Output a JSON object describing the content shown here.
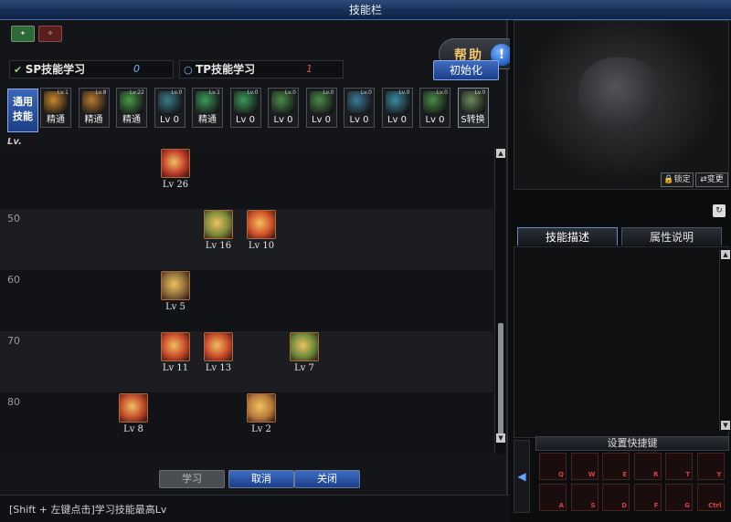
{
  "window": {
    "title": "技能栏"
  },
  "toolbar": {
    "help_label": "帮助",
    "help_icon": "!"
  },
  "sp": {
    "label": "SP技能学习",
    "value": "0"
  },
  "tp": {
    "label": "TP技能学习",
    "value": "1"
  },
  "reset_label": "初始化",
  "common_tab": {
    "line1": "通用",
    "line2": "技能"
  },
  "lv_header": "Lv.",
  "common_skills": [
    {
      "level": "精通",
      "tag": "Lv.1",
      "color": "#c9872e"
    },
    {
      "level": "精通",
      "tag": "Lv.8",
      "color": "#b87a30"
    },
    {
      "level": "精通",
      "tag": "Lv.22",
      "color": "#4a9a4a"
    },
    {
      "level": "Lv 0",
      "tag": "Lv.0",
      "color": "#3a7a8a"
    },
    {
      "level": "精通",
      "tag": "Lv.1",
      "color": "#3a9a5a"
    },
    {
      "level": "Lv 0",
      "tag": "Lv.0",
      "color": "#3a9a5a"
    },
    {
      "level": "Lv 0",
      "tag": "Lv.0",
      "color": "#4a8a4a"
    },
    {
      "level": "Lv 0",
      "tag": "Lv.0",
      "color": "#4a8a4a"
    },
    {
      "level": "Lv 0",
      "tag": "Lv.0",
      "color": "#3a7a9a"
    },
    {
      "level": "Lv 0",
      "tag": "Lv.0",
      "color": "#3a8aa0"
    },
    {
      "level": "Lv 0",
      "tag": "Lv.0",
      "color": "#4a8a4a"
    },
    {
      "level": "S转换",
      "tag": "Lv.0",
      "color": "#6a8a5a"
    }
  ],
  "rows": [
    {
      "label": "",
      "skills": [
        {
          "level": "Lv 26",
          "col": 4,
          "color": "#c03a2a"
        }
      ]
    },
    {
      "label": "50",
      "skills": [
        {
          "level": "Lv 16",
          "col": 5,
          "color": "#7a8a3a"
        },
        {
          "level": "Lv 10",
          "col": 6,
          "color": "#d0502a"
        }
      ]
    },
    {
      "label": "60",
      "skills": [
        {
          "level": "Lv 5",
          "col": 4,
          "color": "#8a6a3a"
        }
      ]
    },
    {
      "label": "70",
      "skills": [
        {
          "level": "Lv 11",
          "col": 4,
          "color": "#c8482a"
        },
        {
          "level": "Lv 13",
          "col": 5,
          "color": "#c8482a"
        },
        {
          "level": "Lv 7",
          "col": 7,
          "color": "#6a8a3a"
        }
      ]
    },
    {
      "label": "80",
      "skills": [
        {
          "level": "Lv 8",
          "col": 3,
          "color": "#c04a2a"
        },
        {
          "level": "Lv 2",
          "col": 6,
          "color": "#b87a3a"
        }
      ]
    }
  ],
  "buttons": {
    "learn": "学习",
    "cancel": "取消",
    "close": "关闭"
  },
  "hint": "[Shift + 左键点击]学习技能最高Lv",
  "preview": {
    "lock_label": "锁定",
    "change_label": "变更"
  },
  "tabs": {
    "description": "技能描述",
    "attributes": "属性说明"
  },
  "shortcut": {
    "title": "设置快捷键",
    "keys": [
      "Q",
      "W",
      "E",
      "R",
      "T",
      "Y",
      "A",
      "S",
      "D",
      "F",
      "G",
      "Ctrl"
    ]
  },
  "colors": {
    "accent": "#1c3f86",
    "bar": "#163059"
  }
}
